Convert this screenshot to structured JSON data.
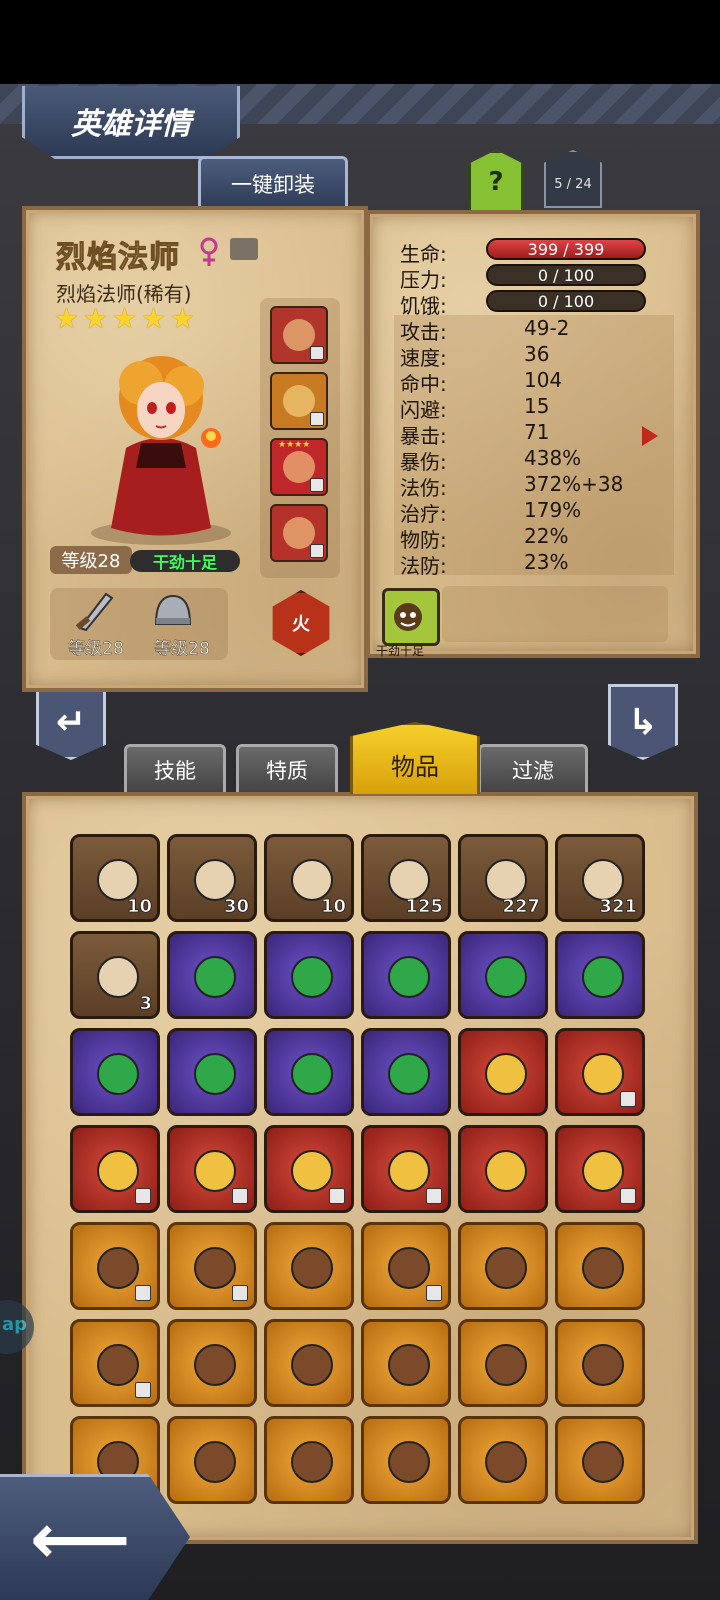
{
  "screen": {
    "title": "英雄详情",
    "unequip_button": "一键卸装",
    "help_button": "?",
    "page_indicator": "5 / 24"
  },
  "hero": {
    "name": "烈焰法师",
    "subtitle": "烈焰法师(稀有)",
    "stars": 5,
    "level": "等级28",
    "mood": "干劲十足",
    "gear": [
      {
        "icon": "sword-icon",
        "level": "等级28"
      },
      {
        "icon": "helmet-icon",
        "level": "等级28"
      }
    ],
    "element": "火",
    "equipment": [
      {
        "icon": "wizard-hat-icon"
      },
      {
        "icon": "blue-helmet-icon"
      },
      {
        "icon": "ruby-ring-icon",
        "stars": "★★★★"
      },
      {
        "icon": "axe-icon"
      }
    ]
  },
  "stats": {
    "hp": {
      "label": "生命:",
      "value": "399 / 399"
    },
    "stress": {
      "label": "压力:",
      "value": "0 / 100"
    },
    "hunger": {
      "label": "饥饿:",
      "value": "0 / 100"
    },
    "rows": [
      {
        "label": "攻击:",
        "value": "49-2"
      },
      {
        "label": "速度:",
        "value": "36"
      },
      {
        "label": "命中:",
        "value": "104"
      },
      {
        "label": "闪避:",
        "value": "15"
      },
      {
        "label": "暴击:",
        "value": "71"
      },
      {
        "label": "暴伤:",
        "value": "438%"
      },
      {
        "label": "法伤:",
        "value": "372%+38"
      },
      {
        "label": "治疗:",
        "value": "179%"
      },
      {
        "label": "物防:",
        "value": "22%"
      },
      {
        "label": "法防:",
        "value": "23%"
      }
    ],
    "trait_label": "干劲十足"
  },
  "tabs": [
    {
      "label": "技能",
      "active": false
    },
    {
      "label": "特质",
      "active": false
    },
    {
      "label": "物品",
      "active": true
    },
    {
      "label": "过滤",
      "active": false
    }
  ],
  "inventory": [
    {
      "icon": "hero-portrait-girl-icon",
      "bg": "brown",
      "count": "10"
    },
    {
      "icon": "hero-portrait-ninja-icon",
      "bg": "brown",
      "count": "30"
    },
    {
      "icon": "hero-portrait-redhair-icon",
      "bg": "brown",
      "count": "10"
    },
    {
      "icon": "fire-crystal-icon",
      "bg": "brown",
      "count": "125"
    },
    {
      "icon": "rune-stone-icon",
      "bg": "brown",
      "count": "227"
    },
    {
      "icon": "potion-flask-icon",
      "bg": "brown",
      "count": "321"
    },
    {
      "icon": "feather-icon",
      "bg": "brown",
      "count": "3"
    },
    {
      "icon": "green-gem-icon",
      "bg": "purple",
      "count": ""
    },
    {
      "icon": "green-gem-icon",
      "bg": "purple",
      "count": ""
    },
    {
      "icon": "green-gem-icon",
      "bg": "purple",
      "count": ""
    },
    {
      "icon": "green-gem-icon",
      "bg": "purple",
      "count": ""
    },
    {
      "icon": "green-gem-icon",
      "bg": "purple",
      "count": ""
    },
    {
      "icon": "green-gem-icon",
      "bg": "purple",
      "count": ""
    },
    {
      "icon": "green-gem-icon",
      "bg": "purple",
      "count": ""
    },
    {
      "icon": "green-gem-icon",
      "bg": "purple",
      "count": ""
    },
    {
      "icon": "green-gem-icon",
      "bg": "purple",
      "count": ""
    },
    {
      "icon": "ruby-ring-icon",
      "bg": "red",
      "count": "",
      "locked": false
    },
    {
      "icon": "blue-orb-amulet-icon",
      "bg": "red",
      "count": "",
      "locked": true
    },
    {
      "icon": "jeweled-sword-icon",
      "bg": "red",
      "count": "",
      "locked": true
    },
    {
      "icon": "horn-icon",
      "bg": "red",
      "count": "",
      "locked": true
    },
    {
      "icon": "crest-helm-icon",
      "bg": "red",
      "count": "",
      "locked": true
    },
    {
      "icon": "cookie-ring-icon",
      "bg": "red",
      "count": "",
      "locked": true
    },
    {
      "icon": "dagger-icon",
      "bg": "red",
      "count": "",
      "locked": false
    },
    {
      "icon": "cloak-icon",
      "bg": "red",
      "count": "",
      "locked": true
    },
    {
      "icon": "crossbow-icon",
      "bg": "orange",
      "count": "",
      "locked": true
    },
    {
      "icon": "pickaxe-icon",
      "bg": "orange",
      "count": "",
      "locked": true
    },
    {
      "icon": "pickaxe-icon",
      "bg": "orange",
      "count": "",
      "locked": false
    },
    {
      "icon": "pickaxe-icon",
      "bg": "orange",
      "count": "",
      "locked": true
    },
    {
      "icon": "spiked-shield-icon",
      "bg": "orange",
      "count": "",
      "locked": false
    },
    {
      "icon": "spiked-shield-icon",
      "bg": "orange",
      "count": "",
      "locked": false
    },
    {
      "icon": "crossed-swords-icon",
      "bg": "orange",
      "count": "",
      "locked": true
    },
    {
      "icon": "green-potion-icon",
      "bg": "orange",
      "count": "",
      "locked": false
    },
    {
      "icon": "green-potion-icon",
      "bg": "orange",
      "count": "",
      "locked": false
    },
    {
      "icon": "green-potion-icon",
      "bg": "orange",
      "count": "",
      "locked": false
    },
    {
      "icon": "armor-chest-icon",
      "bg": "orange",
      "count": "",
      "locked": false
    },
    {
      "icon": "armor-chest-icon",
      "bg": "orange",
      "count": "",
      "locked": false
    },
    {
      "icon": "armor-chest-icon",
      "bg": "orange",
      "count": "",
      "locked": false
    },
    {
      "icon": "blue-crystal-icon",
      "bg": "orange",
      "count": "",
      "locked": false
    },
    {
      "icon": "rifle-icon",
      "bg": "orange",
      "count": "",
      "locked": false
    },
    {
      "icon": "rifle-icon",
      "bg": "orange",
      "count": "",
      "locked": false
    },
    {
      "icon": "rifle-icon",
      "bg": "orange",
      "count": "",
      "locked": false
    },
    {
      "icon": "axe-staff-icon",
      "bg": "orange",
      "count": "",
      "locked": false
    }
  ],
  "side_orb_text": "ap",
  "colors": {
    "accent": "#f6cf2a",
    "parchment": "#d9bd8d",
    "hp_bar": "#d44444"
  }
}
